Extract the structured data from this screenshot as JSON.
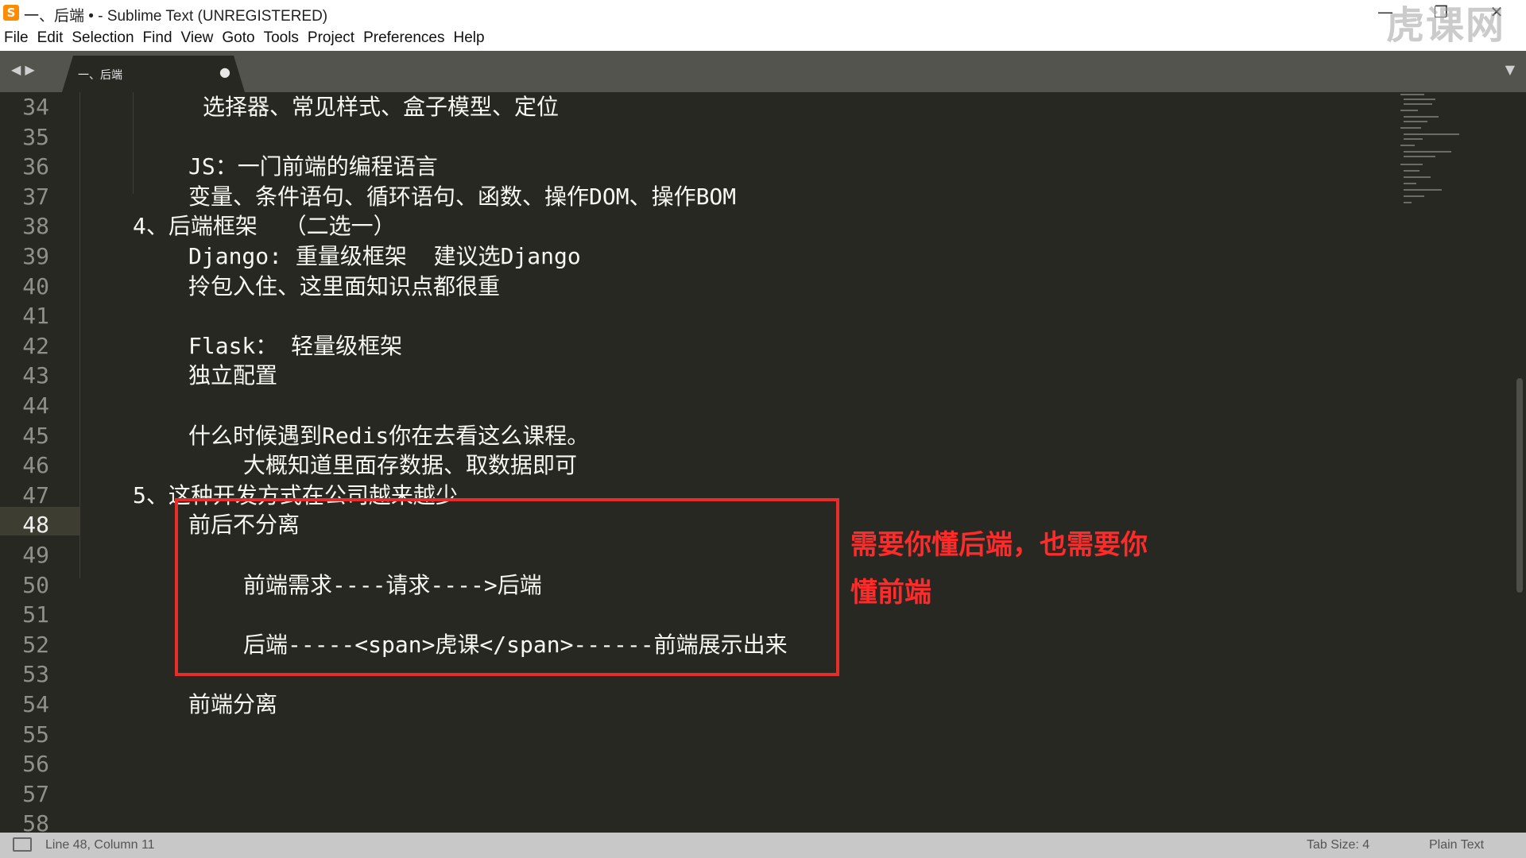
{
  "window": {
    "title": "一、后端 • - Sublime Text (UNREGISTERED)",
    "app_icon": "S",
    "minimize": "—",
    "maximize": "❐",
    "close": "✕"
  },
  "watermark": "虎课网",
  "menu": [
    "File",
    "Edit",
    "Selection",
    "Find",
    "View",
    "Goto",
    "Tools",
    "Project",
    "Preferences",
    "Help"
  ],
  "tabs": {
    "nav": "◀ ▶",
    "active_title": "一、后端",
    "dirty_marker": "●",
    "dropdown": "▼"
  },
  "editor": {
    "current_line": "48",
    "line_numbers": [
      "34",
      "35",
      "36",
      "37",
      "38",
      "39",
      "40",
      "41",
      "42",
      "43",
      "44",
      "45",
      "46",
      "47",
      "48",
      "49",
      "50",
      "51",
      "52",
      "53",
      "54",
      "55",
      "56",
      "57",
      "58"
    ],
    "lines": [
      "选择器、常见样式、盒子模型、定位",
      "",
      "JS：一门前端的编程语言",
      "变量、条件语句、循环语句、函数、操作DOM、操作BOM",
      "4、后端框架  （二选一）",
      "Django: 重量级框架  建议选Django",
      "拎包入住、这里面知识点都很重",
      "",
      "Flask： 轻量级框架",
      "独立配置",
      "",
      "什么时候遇到Redis你在去看这么课程。",
      "大概知道里面存数据、取数据即可",
      "5、这种开发方式在公司越来越少",
      "前后不分离",
      "",
      "前端需求----请求---->后端",
      "",
      "后端-----<span>虎课</span>------前端展示出来",
      "",
      "前端分离",
      "",
      "",
      "",
      ""
    ]
  },
  "annotation": {
    "text": "需要你懂后端，也需要你懂前端",
    "color": "#e82b2b"
  },
  "status": {
    "position": "Line 48, Column 11",
    "tab_size": "Tab Size: 4",
    "syntax": "Plain Text"
  },
  "colors": {
    "editor_bg": "#272822",
    "tabbar_bg": "#53544e",
    "statusbar_bg": "#c8c8c8",
    "annotation_red": "#e82b2b"
  }
}
